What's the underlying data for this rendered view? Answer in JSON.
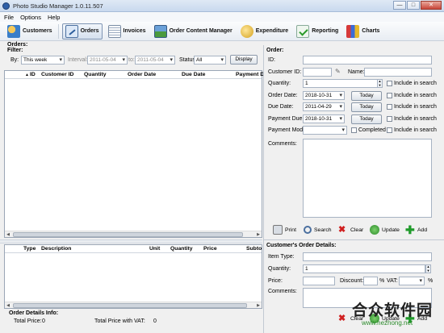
{
  "window": {
    "title": "Photo Studio Manager 1.0.11.507",
    "buttons": {
      "minimize": "—",
      "maximize": "□",
      "close": "✕"
    }
  },
  "menu": [
    "File",
    "Options",
    "Help"
  ],
  "toolbar": [
    {
      "label": "Customers",
      "icon": "customers-icon"
    },
    {
      "label": "Orders",
      "icon": "orders-icon"
    },
    {
      "label": "Invoices",
      "icon": "invoices-icon"
    },
    {
      "label": "Order Content Manager",
      "icon": "order-content-icon"
    },
    {
      "label": "Expenditure",
      "icon": "expenditure-icon"
    },
    {
      "label": "Reporting",
      "icon": "reporting-icon"
    },
    {
      "label": "Charts",
      "icon": "charts-icon"
    }
  ],
  "orders": {
    "section_title": "Orders:",
    "filter_title": "Filter:",
    "by_label": "By:",
    "by_value": "This week",
    "interval_label": "Interval:",
    "interval_from": "2011-05-04",
    "to_label": "to:",
    "interval_to": "2011-05-04",
    "status_label": "Status:",
    "status_value": "All",
    "display_button": "Display",
    "columns": [
      "ID",
      "Customer ID",
      "Quantity",
      "Order Date",
      "Due Date",
      "Payment D"
    ],
    "sort_indicator": "▲"
  },
  "details": {
    "columns": [
      "Type",
      "Description",
      "Unit",
      "Quantity",
      "Price",
      "Subto"
    ],
    "info_title": "Order Details Info:",
    "total_price_label": "Total Price:",
    "total_price_value": "0",
    "total_vat_label": "Total Price with VAT:",
    "total_vat_value": "0"
  },
  "order_form": {
    "title": "Order:",
    "id_label": "ID:",
    "customer_id_label": "Customer ID:",
    "name_label": "Name:",
    "quantity_label": "Quantity:",
    "quantity_value": "1",
    "order_date_label": "Order Date:",
    "order_date_value": "2018-10-31",
    "due_date_label": "Due Date:",
    "due_date_value": "2011-04-29",
    "payment_due_label": "Payment Due:",
    "payment_due_value": "2018-10-31",
    "payment_mode_label": "Payment Mode:",
    "completed_label": "Completed",
    "today_label": "Today",
    "include_label": "Include in search",
    "comments_label": "Comments:",
    "actions": {
      "print": "Print",
      "search": "Search",
      "clear": "Clear",
      "update": "Update",
      "add": "Add"
    }
  },
  "detail_form": {
    "title": "Customer's Order Details:",
    "item_type_label": "Item Type:",
    "quantity_label": "Quantity:",
    "quantity_value": "1",
    "price_label": "Price:",
    "discount_label": "Discount:",
    "percent": "%",
    "vat_label": "VAT:",
    "comments_label": "Comments:",
    "actions": {
      "clear": "Clear",
      "update": "Update",
      "add": "Add"
    }
  },
  "watermark": {
    "text": "合众软件园",
    "url": "www.hezhong.net"
  }
}
